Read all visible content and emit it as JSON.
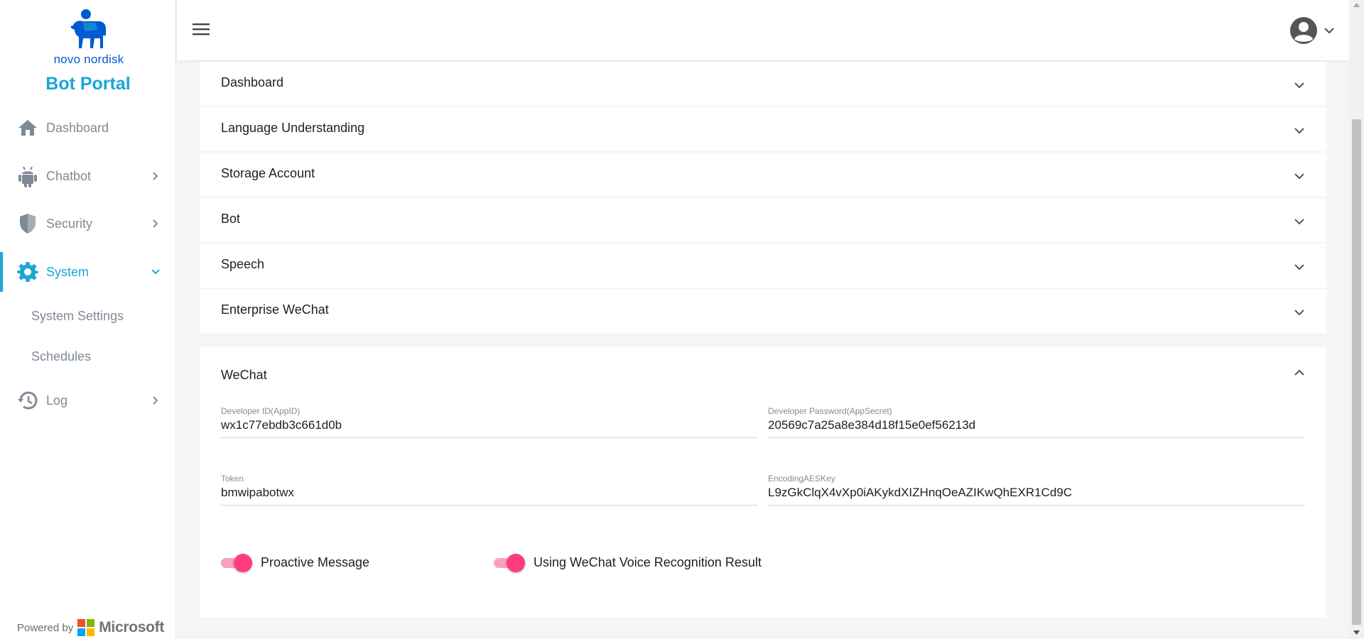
{
  "brand": {
    "logo_text": "novo nordisk",
    "title": "Bot Portal",
    "accent": "#1aa6d6"
  },
  "sidebar": {
    "items": [
      {
        "label": "Dashboard",
        "icon": "home-icon"
      },
      {
        "label": "Chatbot",
        "icon": "android-icon"
      },
      {
        "label": "Security",
        "icon": "shield-icon"
      },
      {
        "label": "System",
        "icon": "gear-icon",
        "active": true
      },
      {
        "label": "Log",
        "icon": "history-icon"
      }
    ],
    "sub_items": [
      {
        "label": "System Settings"
      },
      {
        "label": "Schedules"
      }
    ],
    "powered_by": "Powered by",
    "powered_brand": "Microsoft"
  },
  "panels": [
    {
      "title": "Dashboard"
    },
    {
      "title": "Language Understanding"
    },
    {
      "title": "Storage Account"
    },
    {
      "title": "Bot"
    },
    {
      "title": "Speech"
    },
    {
      "title": "Enterprise WeChat"
    }
  ],
  "wechat": {
    "title": "WeChat",
    "fields": {
      "app_id": {
        "label": "Developer ID(AppID)",
        "value": "wx1c77ebdb3c661d0b"
      },
      "app_secret": {
        "label": "Developer Password(AppSecret)",
        "value": "20569c7a25a8e384d18f15e0ef56213d"
      },
      "token": {
        "label": "Token",
        "value": "bmwipabotwx"
      },
      "aes_key": {
        "label": "EncodingAESKey",
        "value": "L9zGkClqX4vXp0iAKykdXIZHnqOeAZIKwQhEXR1Cd9C"
      }
    },
    "toggles": [
      {
        "label": "Proactive Message",
        "on": true
      },
      {
        "label": "Using WeChat Voice Recognition Result",
        "on": true
      }
    ],
    "toggle_color": "#ff3d7d"
  }
}
